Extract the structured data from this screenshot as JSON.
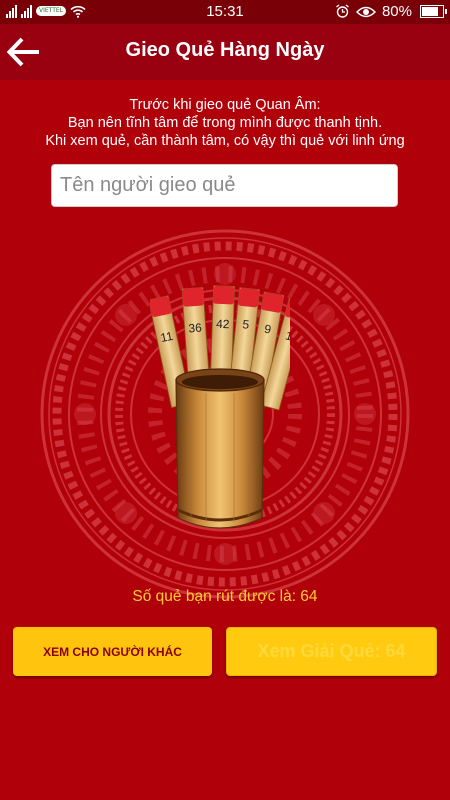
{
  "status_bar": {
    "carrier": "VIETTEL",
    "time": "15:31",
    "battery": "80%",
    "battery_level": 0.8,
    "icons": [
      "signal-icon",
      "signal-icon",
      "wifi-icon",
      "alarm-icon",
      "eye-icon",
      "battery-icon"
    ]
  },
  "header": {
    "title": "Gieo Quẻ Hàng Ngày",
    "back_icon": "arrow-left-icon"
  },
  "instructions": {
    "line1": "Trước khi gieo quẻ Quan Âm:",
    "line2": "Bạn nên tĩnh tâm để trong mình được thanh tịnh.",
    "line3": "Khi xem quẻ, cần thành tâm, có vậy thì quẻ với linh ứng"
  },
  "name_input": {
    "placeholder": "Tên người gieo quẻ",
    "value": ""
  },
  "sticks": [
    "11",
    "36",
    "42",
    "5",
    "9",
    "1"
  ],
  "result": {
    "text": "Số quẻ bạn rút được là: 64"
  },
  "buttons": {
    "other_label": "XEM CHO NGƯỜI KHÁC",
    "explain_label": "Xem Giải Quẻ: 64"
  },
  "colors": {
    "background": "#b0000a",
    "app_bar": "#990010",
    "status_bar": "#7a0008",
    "accent_yellow": "#ffc40d",
    "result_text": "#ffcc33"
  }
}
